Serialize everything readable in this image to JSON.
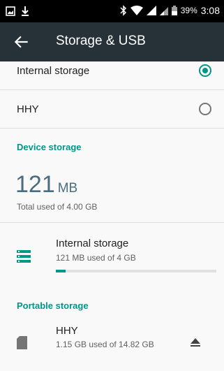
{
  "status_bar": {
    "battery": "39%",
    "time": "3:08",
    "icons": [
      "image-icon",
      "download-icon",
      "bluetooth-icon",
      "wifi-icon",
      "signal-icon",
      "battery-icon"
    ]
  },
  "app_bar": {
    "title": "Storage & USB",
    "back_icon": "arrow-left-icon"
  },
  "storage_options": [
    {
      "label": "Internal storage",
      "selected": true
    },
    {
      "label": "HHY",
      "selected": false
    }
  ],
  "device_storage": {
    "header": "Device storage",
    "used_value": "121",
    "used_unit": "MB",
    "total_text": "Total used of 4.00 GB",
    "item": {
      "title": "Internal storage",
      "subtitle": "121 MB used of 4 GB",
      "progress_fraction": 0.03,
      "icon": "storage-icon"
    }
  },
  "portable_storage": {
    "header": "Portable storage",
    "item": {
      "title": "HHY",
      "subtitle": "1.15 GB used of 14.82 GB",
      "icon": "sd-card-icon",
      "action_icon": "eject-icon"
    }
  },
  "colors": {
    "accent": "#009688",
    "app_bar": "#263238",
    "status_bar": "#000000",
    "big_number": "#4a6d7e"
  }
}
